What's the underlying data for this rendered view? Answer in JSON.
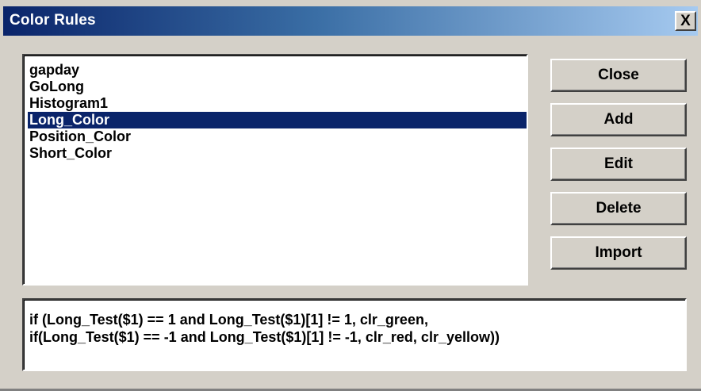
{
  "window": {
    "title": "Color Rules",
    "close_glyph": "X"
  },
  "list": {
    "items": [
      {
        "label": "gapday",
        "selected": false
      },
      {
        "label": "GoLong",
        "selected": false
      },
      {
        "label": "Histogram1",
        "selected": false
      },
      {
        "label": "Long_Color",
        "selected": true
      },
      {
        "label": "Position_Color",
        "selected": false
      },
      {
        "label": "Short_Color",
        "selected": false
      }
    ]
  },
  "buttons": {
    "close": "Close",
    "add": "Add",
    "edit": "Edit",
    "delete": "Delete",
    "import": "Import"
  },
  "formula": {
    "line1": "if (Long_Test($1) == 1 and Long_Test($1)[1] != 1, clr_green,",
    "line2": "if(Long_Test($1) == -1 and Long_Test($1)[1] != -1, clr_red, clr_yellow))"
  },
  "colors": {
    "selection": "#0a246a",
    "face": "#d4d0c8"
  }
}
